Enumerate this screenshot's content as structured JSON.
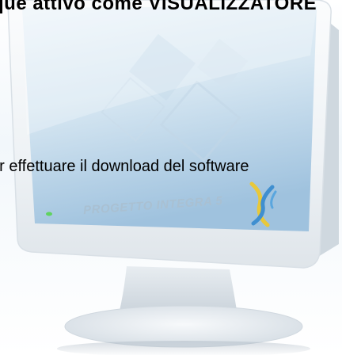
{
  "banner": {
    "text": "que attivo come VISUALIZZATORE"
  },
  "download": {
    "text": "er effettuare il download del software"
  },
  "screen": {
    "brand_text": "PROGETTO INTEGRA 5"
  },
  "icons": {
    "logo": "x-logo-icon",
    "power_led": "power-led-icon"
  },
  "colors": {
    "screen_top": "#e6f0f7",
    "screen_bottom": "#9fc2de",
    "bezel": "#f4f6f8",
    "logo_blue": "#3f8fd0",
    "logo_yellow": "#e8c83a",
    "led_green": "#5fd35f"
  }
}
